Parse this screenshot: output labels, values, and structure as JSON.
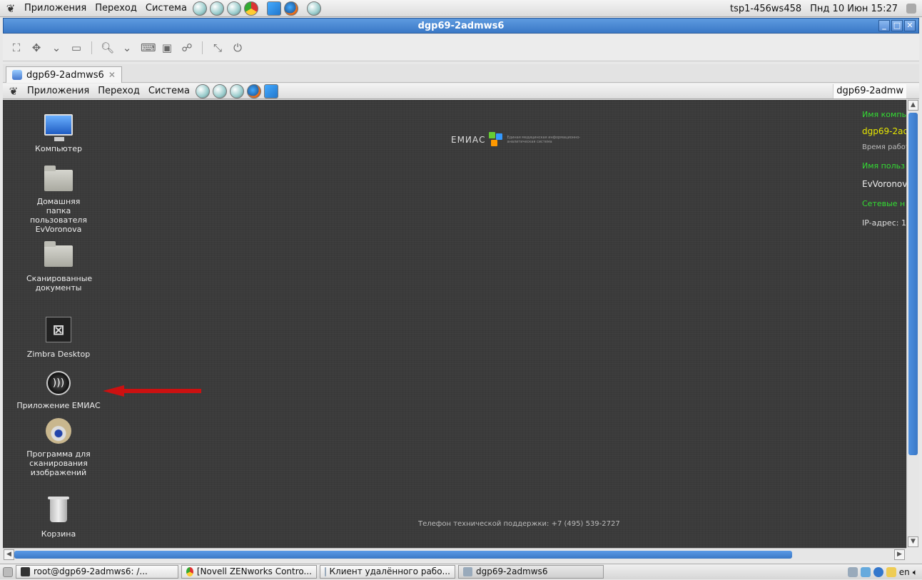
{
  "host_panel": {
    "menus": [
      "Приложения",
      "Переход",
      "Система"
    ],
    "hostname": "tsp1-456ws458",
    "clock": "Пнд 10 Июн 15:27"
  },
  "window": {
    "title": "dgp69-2admws6",
    "tab_label": "dgp69-2admws6"
  },
  "remote_panel": {
    "menus": [
      "Приложения",
      "Переход",
      "Система"
    ],
    "hostname": "dgp69-2admw"
  },
  "desktop": {
    "icons": [
      {
        "label": "Компьютер"
      },
      {
        "label": "Домашняя папка пользователя EvVoronova"
      },
      {
        "label": "Сканированные документы"
      },
      {
        "label": "Zimbra Desktop"
      },
      {
        "label": "Приложение ЕМИАС"
      },
      {
        "label": "Программа для сканирования изображений"
      },
      {
        "label": "Корзина"
      }
    ],
    "logo_text": "ЕМИАС",
    "logo_subtitle": "Единая медицинская информационно-аналитическая система",
    "support_text": "Телефон технической поддержки: +7 (495) 539-2727",
    "conky": {
      "computer_name_label": "Имя компь",
      "computer_name": "dgp69-2ac",
      "uptime_label": "Время работ",
      "user_label": "Имя польз",
      "user_name": "EvVoronov",
      "network_label": "Сетевые н",
      "ip_label": "IP-адрес: 1("
    }
  },
  "taskbar": {
    "tasks": [
      {
        "label": "root@dgp69-2admws6: /..."
      },
      {
        "label": "[Novell ZENworks Contro..."
      },
      {
        "label": "Клиент удалённого рабо..."
      },
      {
        "label": "dgp69-2admws6"
      }
    ],
    "keyboard_layout": "en"
  },
  "colors": {
    "titlebar": "#3a78c6",
    "desktop_bg": "#3b3b3b",
    "conky_green": "#33dd33",
    "conky_yellow": "#e8e800",
    "arrow": "#cc1111"
  }
}
